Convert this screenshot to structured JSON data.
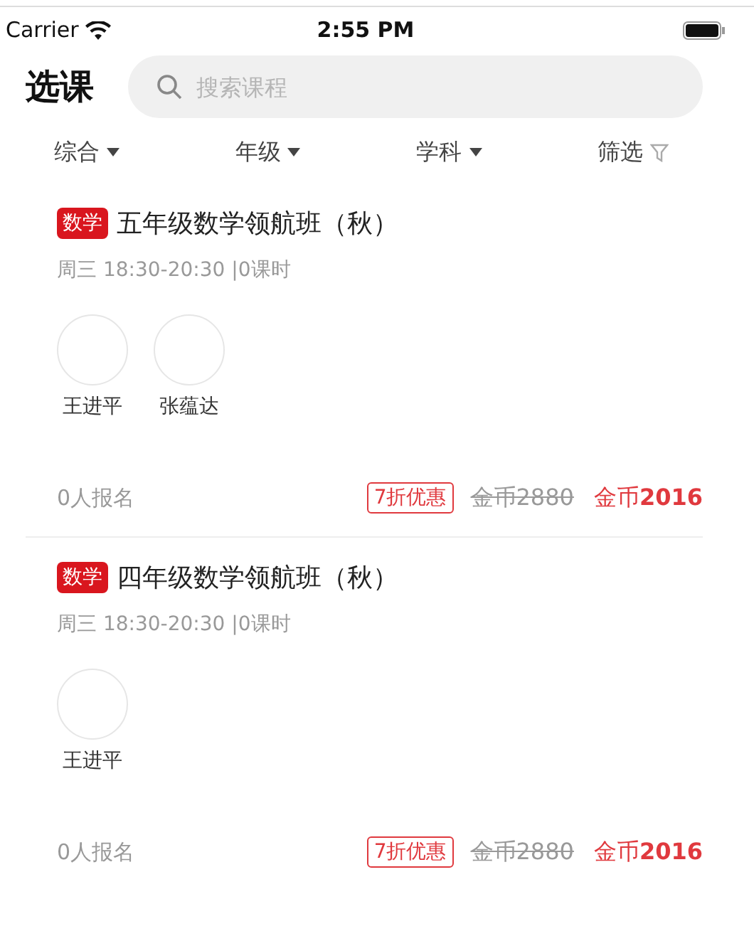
{
  "status_bar": {
    "carrier": "Carrier",
    "time": "2:55 PM"
  },
  "header": {
    "title": "选课",
    "search": {
      "placeholder": "搜索课程"
    }
  },
  "filters": [
    {
      "label": "综合",
      "kind": "dropdown"
    },
    {
      "label": "年级",
      "kind": "dropdown"
    },
    {
      "label": "学科",
      "kind": "dropdown"
    },
    {
      "label": "筛选",
      "kind": "filter"
    }
  ],
  "courses": [
    {
      "subject": "数学",
      "title": "五年级数学领航班（秋）",
      "schedule": "周三 18:30-20:30 |0课时",
      "teachers": [
        {
          "name": "王进平"
        },
        {
          "name": "张蕴达"
        }
      ],
      "enrolled": "0人报名",
      "discount": "7折优惠",
      "original_price": "金币2880",
      "price": "金币**2016**"
    },
    {
      "subject": "数学",
      "title": "四年级数学领航班（秋）",
      "schedule": "周三 18:30-20:30 |0课时",
      "teachers": [
        {
          "name": "王进平"
        }
      ],
      "enrolled": "0人报名",
      "discount": "7折优惠",
      "original_price": "金币2880",
      "price": "金币**2016**"
    }
  ]
}
